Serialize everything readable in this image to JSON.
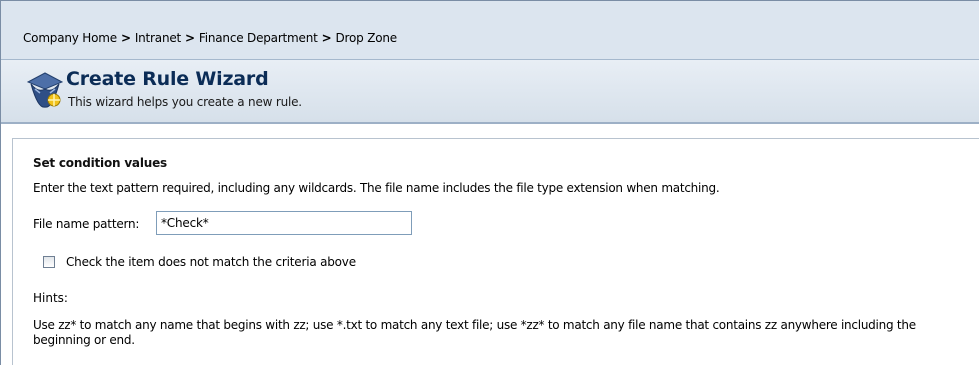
{
  "breadcrumb": {
    "items": [
      "Company Home",
      "Intranet",
      "Finance Department",
      "Drop Zone"
    ],
    "separator": ">"
  },
  "header": {
    "icon": "wizard-icon",
    "title": "Create Rule Wizard",
    "subtitle": "This wizard helps you create a new rule."
  },
  "section": {
    "title": "Set condition values",
    "instructions": "Enter the text pattern required, including any wildcards. The file name includes the file type extension when matching.",
    "field_label": "File name pattern:",
    "field_value": "*Check*",
    "checkbox_label": "Check the item does not match the criteria above",
    "checkbox_checked": false,
    "hints_label": "Hints:",
    "hints_text": "Use zz* to match any name that begins with zz; use *.txt to match any text file; use *zz* to match any file name that contains zz anywhere including the beginning or end."
  },
  "colors": {
    "breadcrumb_bg": "#dce5ef",
    "header_bg": "#d6e0ea",
    "title": "#0b2c56",
    "input_border": "#7f9db9"
  }
}
